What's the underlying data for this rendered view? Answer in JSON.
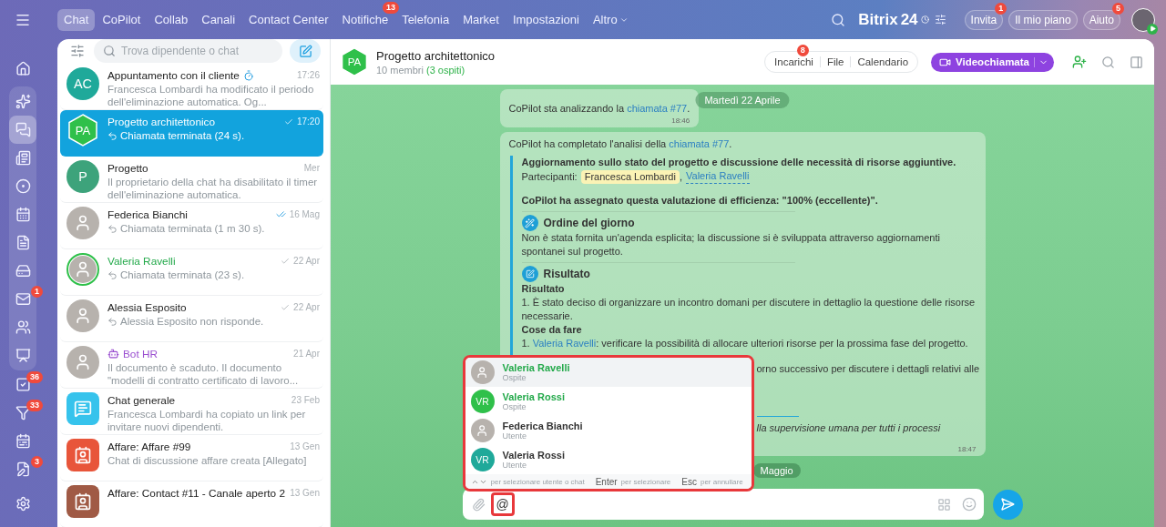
{
  "top_nav": {
    "tabs": [
      {
        "label": "Chat",
        "selected": true
      },
      {
        "label": "CoPilot",
        "selected": false
      },
      {
        "label": "Collab",
        "selected": false
      },
      {
        "label": "Canali",
        "selected": false
      },
      {
        "label": "Contact Center",
        "selected": false
      },
      {
        "label": "Notifiche",
        "selected": false,
        "badge": "13"
      },
      {
        "label": "Telefonia",
        "selected": false
      },
      {
        "label": "Market",
        "selected": false
      },
      {
        "label": "Impostazioni",
        "selected": false
      },
      {
        "label": "Altro",
        "selected": false,
        "dropdown": true
      }
    ],
    "logo": {
      "name": "Bitrix",
      "number": "24"
    },
    "buttons": [
      {
        "label": "Invita",
        "badge": "1"
      },
      {
        "label": "Il mio piano"
      },
      {
        "label": "Aiuto",
        "badge": "5"
      }
    ]
  },
  "rail": {
    "top": [
      {
        "selected": false
      }
    ],
    "group": [
      {
        "selected": false
      },
      {
        "selected": true
      },
      {
        "selected": false
      },
      {
        "selected": false
      },
      {
        "selected": false
      },
      {
        "selected": false
      },
      {
        "selected": false
      },
      {
        "selected": false,
        "badge": "1"
      },
      {
        "selected": false
      },
      {
        "selected": false
      }
    ],
    "after": [
      {
        "selected": false,
        "badge": "36"
      },
      {
        "selected": false,
        "badge": "33"
      },
      {
        "selected": false
      },
      {
        "selected": false,
        "badge": "3"
      }
    ]
  },
  "chat_list": {
    "search": {
      "placeholder": "Trova dipendente o chat"
    },
    "items": [
      {
        "name": "Appuntamento con il cliente",
        "kind": "chat",
        "timer": true,
        "sent": false,
        "read": false,
        "reply_icon": false,
        "time": "17:26",
        "preview": "Francesca Lombardi ha modificato il periodo dell'eliminazione automatica. Og...",
        "selected": false,
        "avatar": {
          "kind": "initials",
          "text": "AC",
          "color": "#1fa99a"
        }
      },
      {
        "name": "Progetto architettonico",
        "kind": "chat",
        "timer": false,
        "sent": true,
        "read": false,
        "reply_icon": true,
        "time": "17:20",
        "preview": "Chiamata terminata (24 s).",
        "selected": true,
        "avatar": {
          "kind": "hexagon",
          "text": "PA",
          "color": "#2fc04a"
        }
      },
      {
        "name": "Progetto",
        "kind": "chat",
        "timer": false,
        "sent": false,
        "read": false,
        "reply_icon": false,
        "time": "Mer",
        "preview": "Il proprietario della chat ha disabilitato il timer dell'eliminazione automatica.",
        "selected": false,
        "avatar": {
          "kind": "initials",
          "text": "P",
          "color": "#3da37b"
        }
      },
      {
        "name": "Federica Bianchi",
        "kind": "user",
        "timer": false,
        "sent": true,
        "read": true,
        "reply_icon": true,
        "time": "16 Mag",
        "preview": "Chiamata terminata (1 m 30 s).",
        "selected": false,
        "avatar": {
          "kind": "photo",
          "ring": false
        }
      },
      {
        "name": "Valeria Ravelli",
        "kind": "guest",
        "timer": false,
        "sent": true,
        "read": false,
        "reply_icon": true,
        "time": "22 Apr",
        "preview": "Chiamata terminata (23 s).",
        "selected": false,
        "avatar": {
          "kind": "photo",
          "ring": true
        }
      },
      {
        "name": "Alessia Esposito",
        "kind": "user",
        "timer": false,
        "sent": true,
        "read": false,
        "reply_icon": true,
        "time": "22 Apr",
        "preview": "Alessia Esposito non risponde.",
        "selected": false,
        "avatar": {
          "kind": "photo",
          "ring": false
        }
      },
      {
        "name": "Bot HR",
        "kind": "bot",
        "timer": false,
        "sent": false,
        "read": false,
        "reply_icon": false,
        "time": "21 Apr",
        "preview": "Il documento è scaduto. Il documento \"modelli di contratto certificato di lavoro...",
        "selected": false,
        "avatar": {
          "kind": "photo",
          "ring": false
        }
      },
      {
        "name": "Chat generale",
        "kind": "chat",
        "timer": false,
        "sent": false,
        "read": false,
        "reply_icon": false,
        "time": "23 Feb",
        "preview": "Francesca Lombardi ha copiato un link per invitare nuovi dipendenti.",
        "selected": false,
        "avatar": {
          "kind": "chat-icon"
        }
      },
      {
        "name": "Affare: Affare #99",
        "kind": "chat",
        "timer": false,
        "sent": false,
        "read": false,
        "reply_icon": false,
        "time": "13 Gen",
        "preview": "Chat di discussione affare creata [Allegato]",
        "selected": false,
        "avatar": {
          "kind": "deal-icon"
        }
      },
      {
        "name": "Affare: Contact #11 - Canale aperto 2",
        "kind": "chat",
        "timer": false,
        "sent": false,
        "read": false,
        "time": "13 Gen",
        "selected": false,
        "avatar": {
          "kind": "deal-icon-dark"
        }
      }
    ]
  },
  "chat": {
    "title": "Progetto architettonico",
    "avatar": {
      "text": "PA"
    },
    "members": "10 membri",
    "guests": "(3 ospiti)",
    "tabs": [
      {
        "label": "Incarichi",
        "badge": "8"
      },
      {
        "label": "File"
      },
      {
        "label": "Calendario"
      }
    ],
    "call_button": "Videochiamata",
    "date_pills": [
      "Martedì 22 Aprile",
      "Maggio"
    ],
    "message_1": {
      "text": "CoPilot sta analizzando la ",
      "link": "chiamata #77",
      "after": ".",
      "time": "18:46"
    },
    "message_2": {
      "text": "CoPilot ha completato l'analisi della ",
      "link": "chiamata #77",
      "after": ".",
      "time": "18:47",
      "title": "Aggiornamento sullo stato del progetto e discussione delle necessità di risorse aggiuntive.",
      "participants_label": "Partecipanti:",
      "participants": [
        {
          "name": "Francesca Lombardi",
          "kind": "highlight"
        },
        {
          "name": "Valeria Ravelli",
          "kind": "link"
        }
      ],
      "separator": ",",
      "rating": "CoPilot ha assegnato questa valutazione di efficienza: \"100% (eccellente)\".",
      "sections": [
        {
          "kind": "agenda",
          "heading": "Ordine del giorno",
          "lines": [
            {
              "kind": "text",
              "text": "Non è stata fornita un'agenda esplicita; la discussione si è sviluppata attraverso aggiornamenti spontanei sul progetto."
            }
          ]
        },
        {
          "kind": "result",
          "heading": "Risultato",
          "lines": [
            {
              "kind": "subheading",
              "text": "Risultato"
            },
            {
              "kind": "text",
              "text": "1. È stato deciso di organizzare un incontro domani per discutere in dettaglio la questione delle risorse necessarie."
            },
            {
              "kind": "subheading",
              "text": "Cose da fare"
            },
            {
              "kind": "link-item",
              "number": "1. ",
              "link": "Valeria Ravelli",
              "text": ": verificare la possibilità di allocare ulteriori risorse per la prossima fase del progetto."
            },
            {
              "kind": "covered",
              "text": "orno successivo per discutere i dettagli relativi alle"
            }
          ]
        },
        {
          "kind": "covered",
          "lines": [
            {
              "kind": "covered-italic",
              "text": "lla supervisione umana per tutti i processi"
            }
          ]
        }
      ]
    },
    "mention_popup": {
      "items": [
        {
          "name": "Valeria Ravelli",
          "role": "Ospite",
          "kind": "guest",
          "selected": true,
          "avatar": {
            "kind": "photo"
          }
        },
        {
          "name": "Valeria Rossi",
          "role": "Ospite",
          "kind": "guest",
          "selected": false,
          "avatar": {
            "kind": "initials",
            "text": "VR",
            "color": "#2fc04a"
          }
        },
        {
          "name": "Federica Bianchi",
          "role": "Utente",
          "kind": "user",
          "selected": false,
          "avatar": {
            "kind": "photo"
          }
        },
        {
          "name": "Valeria Rossi",
          "role": "Utente",
          "kind": "user",
          "selected": false,
          "avatar": {
            "kind": "initials",
            "text": "VR",
            "color": "#1fa99a"
          }
        }
      ],
      "hints": [
        {
          "kind": "arrows",
          "text": "per selezionare utente o chat"
        },
        {
          "kind": "key",
          "key": "Enter",
          "text": "per selezionare"
        },
        {
          "kind": "key",
          "key": "Esc",
          "text": "per annullare"
        }
      ]
    },
    "composer": {
      "value": "@"
    }
  }
}
